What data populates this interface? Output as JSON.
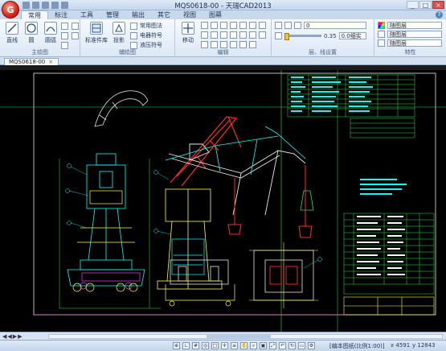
{
  "app": {
    "window_title": "MQS0618-00 - 天瑞CAD2013",
    "logo_letter": "G"
  },
  "tabs": [
    "常用",
    "标注",
    "工具",
    "管理",
    "输出",
    "其它",
    "视图",
    "图幕"
  ],
  "ribbon": {
    "draw_group": {
      "label": "主绘图",
      "buttons": [
        "直线",
        "圆",
        "圆弧"
      ]
    },
    "aux_group": {
      "label": "辅绘图",
      "buttons": [
        "标准件库",
        "投影"
      ],
      "small_items": [
        "常用图法",
        "电器符号",
        "液压符号"
      ]
    },
    "edit_group": {
      "label": "编辑",
      "buttons": [
        "移动"
      ]
    },
    "layer_group": {
      "label": "层、线设置",
      "slider_value": "0.35",
      "line_width": "0.0细实",
      "layer_value": "0"
    },
    "props_group": {
      "label": "特性",
      "color_value": "随图层",
      "linetype_value": "随图层",
      "weight_value": "随图层"
    }
  },
  "document_tab": {
    "name": "MQS0618-00",
    "close": "×"
  },
  "status": {
    "text": "[编本图纸(比例1:00)]",
    "x": "x 4591",
    "y": "y 12843"
  },
  "colors": {
    "canvas_bg": "#000000",
    "crane_red": "#ff2a2a",
    "line_cyan": "#00ffff",
    "line_green": "#35e04b",
    "line_yellow": "#ffff40",
    "line_magenta": "#ff39ff"
  }
}
